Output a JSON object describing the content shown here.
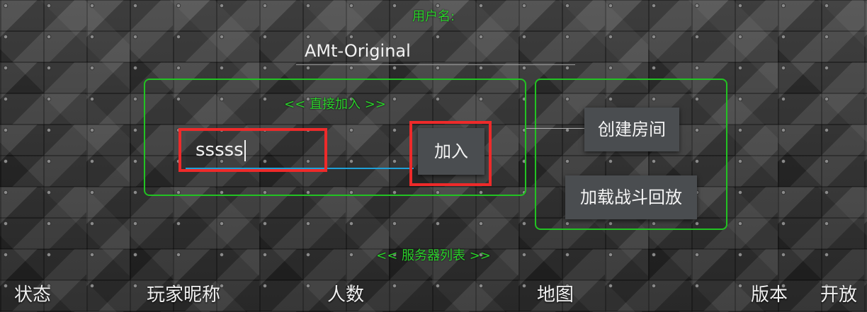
{
  "username": {
    "label": "用户名:",
    "value": "AMt-Original"
  },
  "direct_join": {
    "label": "<< 直接加入 >>",
    "input_value": "sssss",
    "join_label": "加入"
  },
  "room_actions": {
    "create_room_label": "创建房间",
    "load_replay_label": "加载战斗回放"
  },
  "server_list": {
    "label": "<< 服务器列表 >>",
    "columns": [
      "状态",
      "玩家昵称",
      "人数",
      "地图",
      "版本",
      "开放"
    ]
  },
  "colors": {
    "accent_green": "#22c322",
    "highlight_red": "#ee2a2a",
    "input_underline_blue": "#1fa0d8"
  }
}
